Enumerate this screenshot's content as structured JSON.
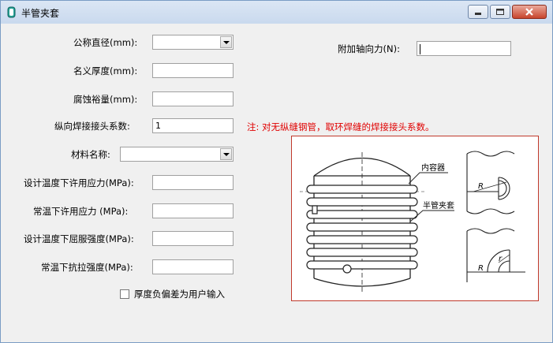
{
  "window": {
    "title": "半管夹套"
  },
  "form": {
    "nominal_diameter_label": "公称直径(mm):",
    "nominal_thickness_label": "名义厚度(mm):",
    "corrosion_allowance_label": "腐蚀裕量(mm):",
    "weld_coef_label": "纵向焊接接头系数:",
    "weld_coef_value": "1",
    "material_label": "材料名称:",
    "allow_stress_design_label": "设计温度下许用应力(MPa):",
    "allow_stress_room_label": "常温下许用应力 (MPa):",
    "yield_strength_design_label": "设计温度下屈服强度(MPa):",
    "tensile_strength_room_label": "常温下抗拉强度(MPa):",
    "axial_force_label": "附加轴向力(N):",
    "thickness_tolerance_checkbox_label": "厚度负偏差为用户输入",
    "note": "注: 对无纵缝钢管，取环焊缝的焊接接头系数。"
  },
  "figure": {
    "inner_vessel_label": "内容器",
    "half_pipe_label": "半管夹套",
    "radius_label": "R",
    "small_r_label": "r"
  }
}
